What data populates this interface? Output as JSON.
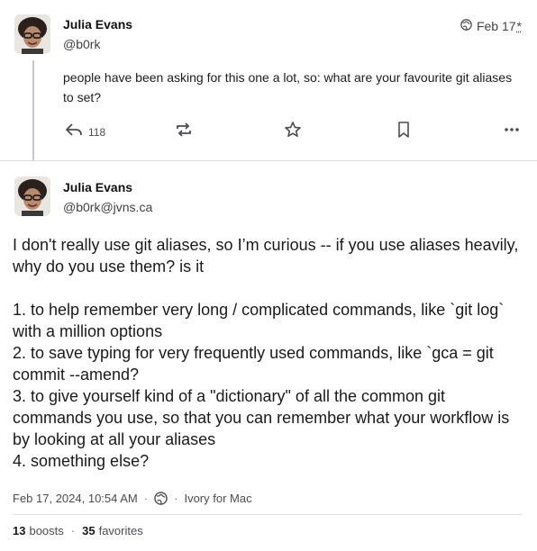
{
  "post1": {
    "author_name": "Julia Evans",
    "author_handle": "@b0rk",
    "date": "Feb 17",
    "edited_mark": "*",
    "text": "people have been asking for this one a lot, so: what are your favourite git aliases to set?",
    "reply_count": "118",
    "icons": {
      "visibility": "globe-icon",
      "reply": "reply-icon",
      "boost": "boost-icon",
      "favorite": "star-icon",
      "bookmark": "bookmark-icon",
      "more": "more-icon"
    }
  },
  "post2": {
    "author_name": "Julia Evans",
    "author_handle": "@b0rk@jvns.ca",
    "paragraphs": [
      "I don't really use git aliases, so I’m curious -- if you use aliases heavily, why do you use them? is it",
      "1. to help remember very long / complicated commands, like `git log` with a million options",
      "2. to save typing for very frequently used commands, like `gca = git commit --amend?",
      "3. to give yourself kind of a \"dictionary\" of all the common git commands you use, so that you can remember what your workflow is by looking at all your aliases",
      "4. something else?"
    ],
    "timestamp": "Feb 17, 2024, 10:54 AM",
    "client": "Ivory for Mac",
    "boosts_count": "13",
    "boosts_label": "boosts",
    "favorites_count": "35",
    "favorites_label": "favorites"
  }
}
